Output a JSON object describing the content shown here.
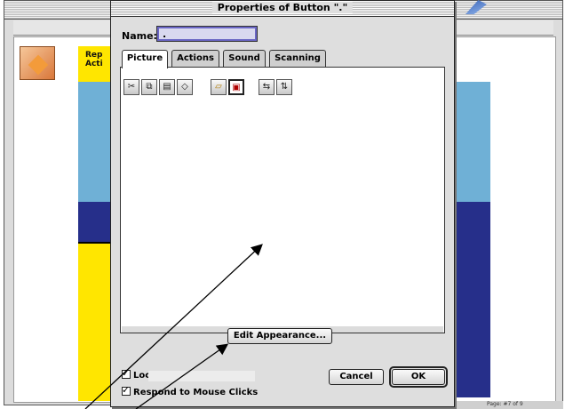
{
  "background": {
    "tile_label": "Rep\nActi",
    "page_indicator": "Page: #7 of 9",
    "colors": {
      "light_blue": "#6fb0d6",
      "navy": "#262f8a",
      "yellow": "#ffe600"
    },
    "app_icon": "app-logo-icon"
  },
  "dialog": {
    "title": "Properties of Button \".\"",
    "name_label": "Name:",
    "name_value": ".",
    "tabs": [
      {
        "label": "Picture",
        "active": true
      },
      {
        "label": "Actions",
        "active": false
      },
      {
        "label": "Sound",
        "active": false
      },
      {
        "label": "Scanning",
        "active": false
      }
    ],
    "toolbar": [
      {
        "icon": "scissors-icon",
        "glyph": "✂"
      },
      {
        "icon": "copy-icon",
        "glyph": "⧉"
      },
      {
        "icon": "paste-icon",
        "glyph": "▤"
      },
      {
        "icon": "eraser-icon",
        "glyph": "◇"
      },
      {
        "icon": "open-folder-icon",
        "glyph": "▱"
      },
      {
        "icon": "picture-library-icon",
        "glyph": "▣"
      },
      {
        "icon": "flip-horizontal-icon",
        "glyph": "⇆"
      },
      {
        "icon": "flip-vertical-icon",
        "glyph": "⇅"
      }
    ],
    "edit_appearance_label": "Edit Appearance...",
    "checkboxes": [
      {
        "label": "Lock",
        "checked": true
      },
      {
        "label": "Respond to Mouse Clicks",
        "checked": true
      }
    ],
    "cancel_label": "Cancel",
    "ok_label": "OK"
  }
}
